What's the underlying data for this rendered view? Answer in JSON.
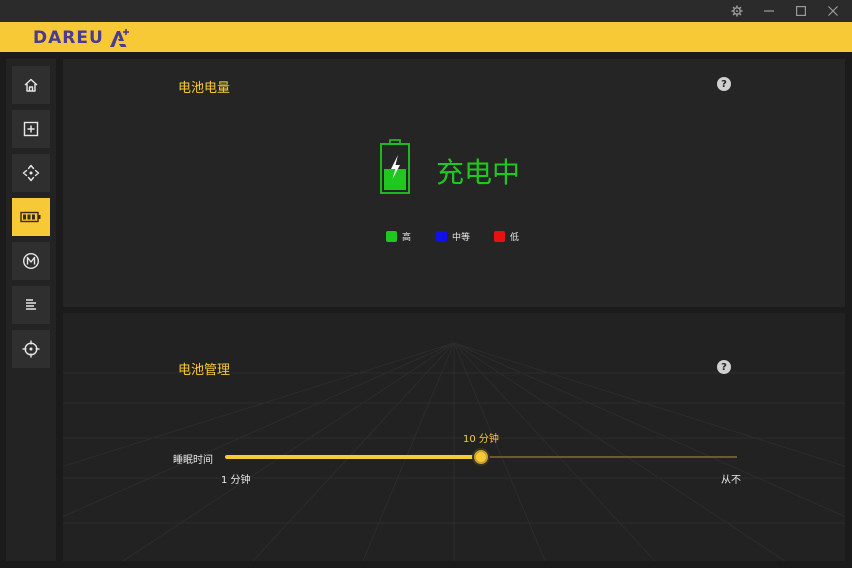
{
  "window": {
    "controls": {
      "settings": "⚙",
      "minimize": "—",
      "maximize": "☐",
      "close": "✕"
    }
  },
  "header": {
    "brand": "DAREU",
    "accent_color": "#f8c937",
    "brand_color": "#4a3a92"
  },
  "sidebar": {
    "items": [
      {
        "icon": "home-icon",
        "active": false
      },
      {
        "icon": "plus-square-icon",
        "active": false
      },
      {
        "icon": "move-arrows-icon",
        "active": false
      },
      {
        "icon": "battery-icon",
        "active": true
      },
      {
        "icon": "macro-m-icon",
        "active": false
      },
      {
        "icon": "text-lines-icon",
        "active": false
      },
      {
        "icon": "crosshair-icon",
        "active": false
      }
    ]
  },
  "battery_panel": {
    "title": "电池电量",
    "help": "?",
    "status": "充电中",
    "status_color": "#1ec81e",
    "legend": [
      {
        "label": "高",
        "color": "#1ec81e"
      },
      {
        "label": "中等",
        "color": "#1010e8"
      },
      {
        "label": "低",
        "color": "#e81010"
      }
    ]
  },
  "management_panel": {
    "title": "电池管理",
    "help": "?",
    "sleep": {
      "label": "睡眠时间",
      "current": "10 分钟",
      "min_label": "1 分钟",
      "max_label": "从不",
      "position_fraction": 0.5
    }
  }
}
